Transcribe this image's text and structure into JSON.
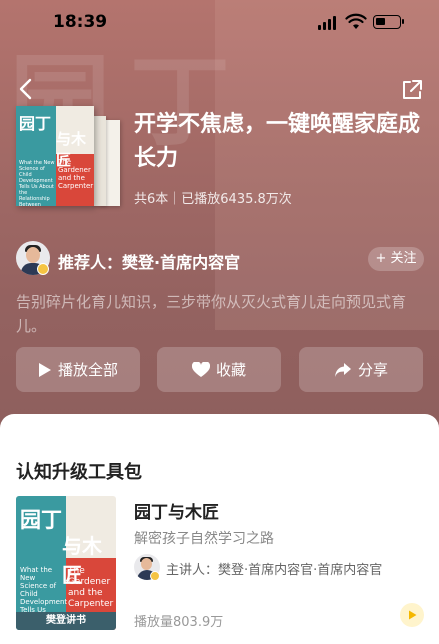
{
  "status": {
    "time": "18:39"
  },
  "book": {
    "title": "开学不焦虑，一键唤醒家庭成长力",
    "meta": "共6本｜已播放6435.8万次",
    "cover": {
      "title_cn_1": "园丁",
      "title_cn_2": "与木匠",
      "title_en": "The Gardener and the Carpenter",
      "subtitle_en": "What the New Science of Child Development Tells Us About the Relationship Between Parents and Children"
    }
  },
  "recommender": {
    "label": "推荐人：樊登·首席内容官",
    "follow": "+ 关注"
  },
  "description": "告别碎片化育儿知识，三步带你从灭火式育儿走向预见式育儿。",
  "actions": {
    "play_all": "播放全部",
    "favorite": "收藏",
    "share": "分享"
  },
  "section": {
    "title": "认知升级工具包",
    "item": {
      "title": "园丁与木匠",
      "subtitle": "解密孩子自然学习之路",
      "lecturer": "主讲人：樊登·首席内容官·首席内容官",
      "plays": "播放量803.9万",
      "cover_footer": "樊登讲书"
    }
  },
  "colors": {
    "accent": "#f5c443",
    "hero": "#a36a66",
    "teal": "#3a9aa0",
    "red": "#d9473a"
  }
}
